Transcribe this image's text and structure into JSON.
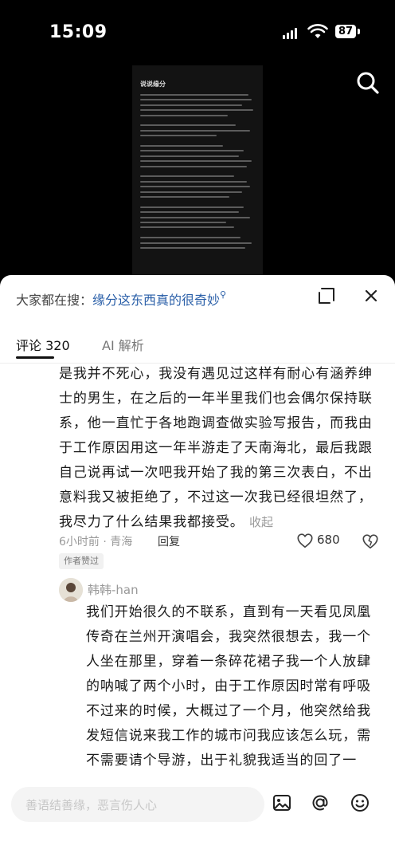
{
  "status_bar": {
    "time": "15:09",
    "battery": "87"
  },
  "video": {
    "title": "说说缘分"
  },
  "header": {
    "search_prefix": "大家都在搜：",
    "search_query": "缘分这东西真的很奇妙"
  },
  "tabs": [
    {
      "label": "评论 320"
    },
    {
      "label": "AI 解析"
    }
  ],
  "comments": [
    {
      "text": "是我并不死心，我没有遇见过这样有耐心有涵养绅士的男生，在之后的一年半里我们也会偶尔保持联系，他一直忙于各地跑调查做实验写报告，而我由于工作原因用这一年半游走了天南海北，最后我跟自己说再试一次吧我开始了我的第三次表白，不出意料我又被拒绝了，不过这一次我已经很坦然了，我尽力了什么结果我都接受。",
      "collapse_label": "收起",
      "time_location": "6小时前 · 青海",
      "reply_label": "回复",
      "likes": "680",
      "badge": "作者赞过"
    },
    {
      "username": "韩韩-han",
      "text": "我们开始很久的不联系，直到有一天看见凤凰传奇在兰州开演唱会，我突然很想去，我一个人坐在那里，穿着一条碎花裙子我一个人放肆的呐喊了两个小时，由于工作原因时常有呼吸不过来的时候，大概过了一个月，他突然给我发短信说来我工作的城市问我应该怎么玩，需不需要请个导游，出于礼貌我适当的回了一下，并说如果你有时间可以等我下班我请你吃"
    }
  ],
  "input_bar": {
    "placeholder": "善语结善缘，恶言伤人心"
  },
  "colors": {
    "link_blue": "#2a5fa8",
    "sheet_bg": "#ffffff",
    "video_bg": "#000000"
  },
  "icons": [
    "search-icon",
    "expand-icon",
    "close-icon",
    "heart-icon",
    "broken-heart-icon",
    "image-icon",
    "at-icon",
    "emoji-icon"
  ]
}
